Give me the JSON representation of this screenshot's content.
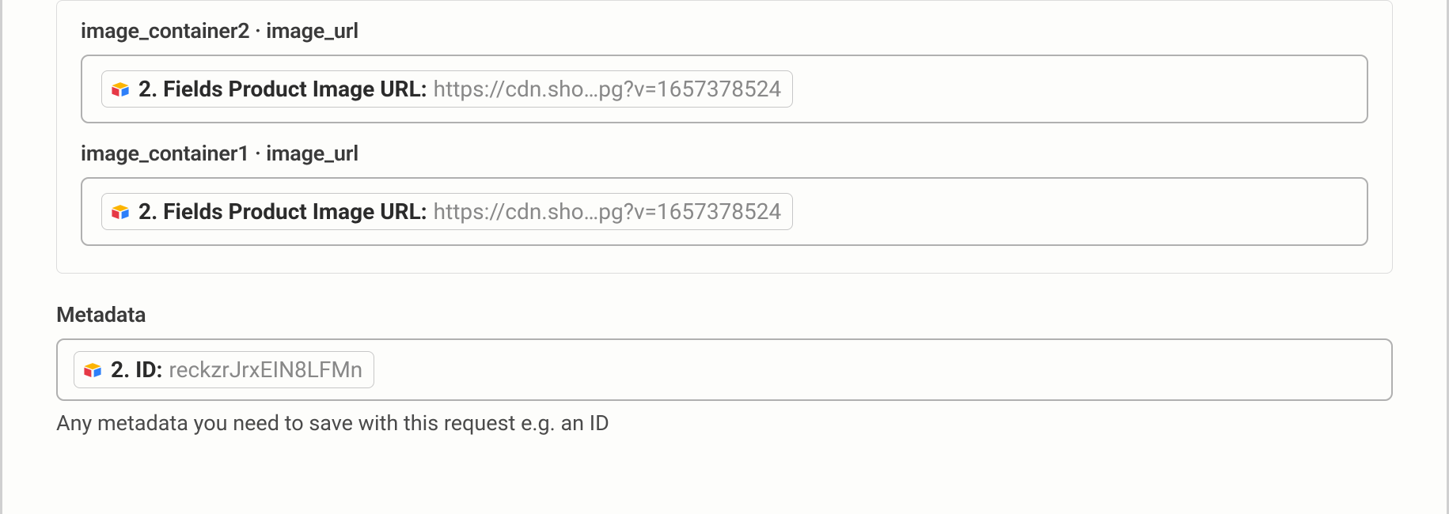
{
  "group": {
    "fields": [
      {
        "label": "image_container2 · image_url",
        "token_prefix": "2. Fields Product Image URL:",
        "token_value": "https://cdn.sho…pg?v=1657378524"
      },
      {
        "label": "image_container1 · image_url",
        "token_prefix": "2. Fields Product Image URL:",
        "token_value": "https://cdn.sho…pg?v=1657378524"
      }
    ]
  },
  "metadata": {
    "heading": "Metadata",
    "token_prefix": "2. ID:",
    "token_value": "reckzrJrxEIN8LFMn",
    "helper": "Any metadata you need to save with this request e.g. an ID"
  }
}
